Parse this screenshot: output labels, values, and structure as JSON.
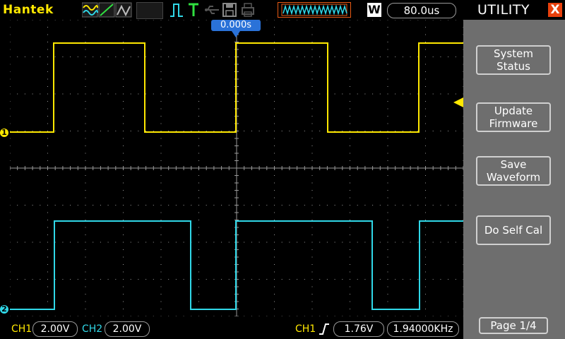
{
  "header": {
    "brand": "Hantek",
    "timebase": "80.0us",
    "w_label": "W",
    "trigger_position": "0.000s"
  },
  "menu": {
    "title": "UTILITY",
    "close": "X",
    "buttons": [
      {
        "label": "System Status"
      },
      {
        "label": "Update Firmware"
      },
      {
        "label": "Save Waveform"
      },
      {
        "label": "Do Self Cal"
      }
    ],
    "page": "Page 1/4"
  },
  "footer": {
    "ch1_label": "CH1",
    "ch1_scale": "2.00V",
    "ch2_label": "CH2",
    "ch2_scale": "2.00V",
    "trig_source": "CH1",
    "trig_level": "1.76V",
    "frequency": "1.94000KHz"
  },
  "channels": {
    "ch1_marker": "1",
    "ch2_marker": "2",
    "ch1_color": "#ffe800",
    "ch2_color": "#30d8e8"
  },
  "colors": {
    "grid": "#9a9a9a",
    "accent_blue": "#2a72d8",
    "close_red": "#e8400c"
  }
}
